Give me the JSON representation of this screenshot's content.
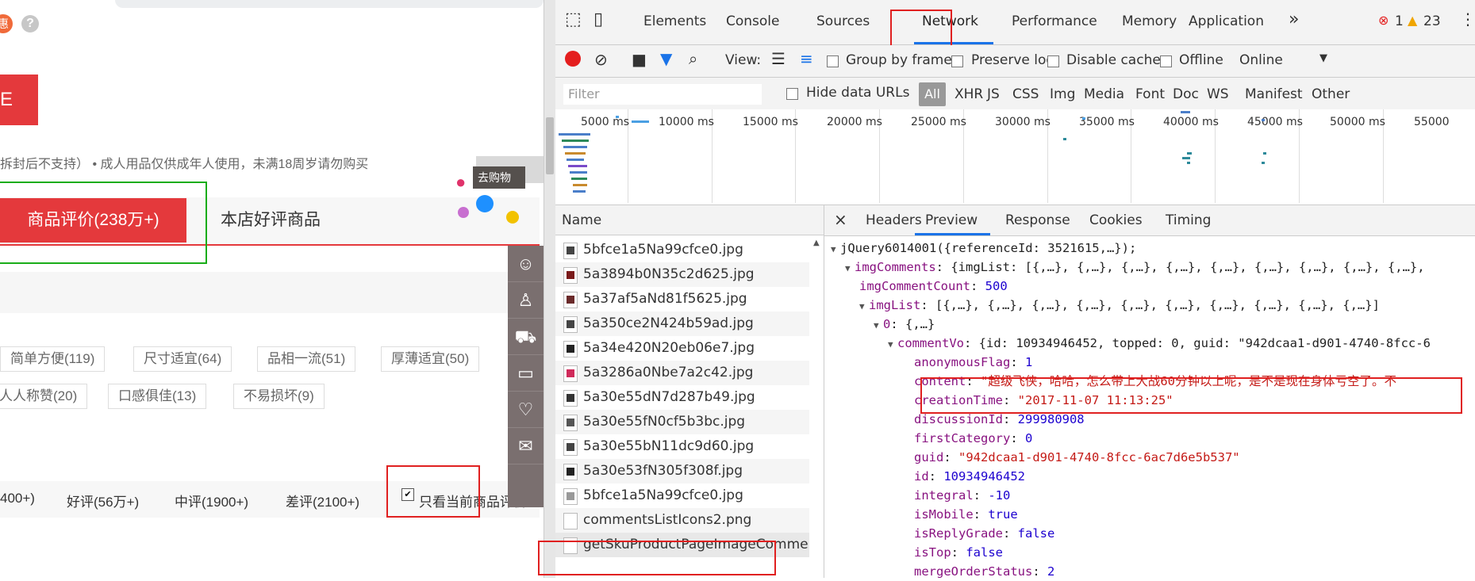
{
  "page": {
    "promo_glyph": "惠",
    "help_glyph": "?",
    "red_button_label": "E",
    "notice": "拆封后不支持）  • 成人用品仅供成年人使用，未满18周岁请勿购买",
    "floatbar_text": "去购物",
    "tabs": {
      "reviews": "商品评价(238万+)",
      "good_products": "本店好评商品"
    },
    "tags": [
      "简单方便(119)",
      "尺寸适宜(64)",
      "品相一流(51)",
      "厚薄适宜(50)",
      "人人称赞(20)",
      "口感俱佳(13)",
      "不易损坏(9)"
    ],
    "filters": [
      "400+)",
      "好评(56万+)",
      "中评(1900+)",
      "差评(2100+)"
    ],
    "only_current_label": "只看当前商品评价",
    "only_current_checked": true
  },
  "devtools": {
    "main_tabs": [
      "Elements",
      "Console",
      "Sources",
      "Network",
      "Performance",
      "Memory",
      "Application"
    ],
    "more_tabs": "»",
    "error_count": "1",
    "warning_count": "23",
    "toolbar": {
      "view_label": "View:",
      "group_by_frame": "Group by frame",
      "preserve_log": "Preserve log",
      "disable_cache": "Disable cache",
      "offline": "Offline",
      "throttle": "Online"
    },
    "filter_placeholder": "Filter",
    "hide_data_urls": "Hide data URLs",
    "type_filters": [
      "All",
      "XHR",
      "JS",
      "CSS",
      "Img",
      "Media",
      "Font",
      "Doc",
      "WS",
      "Manifest",
      "Other"
    ],
    "timeline_ticks": [
      "5000 ms",
      "10000 ms",
      "15000 ms",
      "20000 ms",
      "25000 ms",
      "30000 ms",
      "35000 ms",
      "40000 ms",
      "45000 ms",
      "50000 ms",
      "55000"
    ],
    "name_header": "Name",
    "requests": [
      "5bfce1a5Na99cfce0.jpg",
      "5a3894b0N35c2d625.jpg",
      "5a37af5aNd81f5625.jpg",
      "5a350ce2N424b59ad.jpg",
      "5a34e420N20eb06e7.jpg",
      "5a3286a0Nbe7a2c42.jpg",
      "5a30e55dN7d287b49.jpg",
      "5a30e55fN0cf5b3bc.jpg",
      "5a30e55bN11dc9d60.jpg",
      "5a30e53fN305f308f.jpg",
      "5bfce1a5Na99cfce0.jpg",
      "commentsListIcons2.png",
      "getSkuProductPageImageCommen"
    ],
    "detail_close": "×",
    "detail_tabs": [
      "Headers",
      "Preview",
      "Response",
      "Cookies",
      "Timing"
    ],
    "preview": {
      "root": "jQuery6014001({referenceId: 3521615,…});",
      "imgComments_key": "imgComments",
      "imgComments_val": "{imgList: [{,…}, {,…}, {,…}, {,…}, {,…}, {,…}, {,…}, {,…}, {,…},",
      "imgCommentCount_key": "imgCommentCount",
      "imgCommentCount_val": "500",
      "imgList_key": "imgList",
      "imgList_val": "[{,…}, {,…}, {,…}, {,…}, {,…}, {,…}, {,…}, {,…}, {,…}, {,…}]",
      "idx0_key": "0",
      "idx0_val": "{,…}",
      "commentVo_key": "commentVo",
      "commentVo_val": "{id: 10934946452, topped: 0, guid: \"942dcaa1-d901-4740-8fcc-6",
      "fields": [
        {
          "key": "anonymousFlag",
          "val": "1",
          "type": "n"
        },
        {
          "key": "content",
          "val": "\"超级飞侠，哈哈，怎么带上大战60分钟以上呢，是不是现在身体亏空了。不",
          "type": "s"
        },
        {
          "key": "creationTime",
          "val": "\"2017-11-07 11:13:25\"",
          "type": "s"
        },
        {
          "key": "discussionId",
          "val": "299980908",
          "type": "n"
        },
        {
          "key": "firstCategory",
          "val": "0",
          "type": "n"
        },
        {
          "key": "guid",
          "val": "\"942dcaa1-d901-4740-8fcc-6ac7d6e5b537\"",
          "type": "s"
        },
        {
          "key": "id",
          "val": "10934946452",
          "type": "n"
        },
        {
          "key": "integral",
          "val": "-10",
          "type": "n"
        },
        {
          "key": "isMobile",
          "val": "true",
          "type": "n"
        },
        {
          "key": "isReplyGrade",
          "val": "false",
          "type": "n"
        },
        {
          "key": "isTop",
          "val": "false",
          "type": "n"
        },
        {
          "key": "mergeOrderStatus",
          "val": "2",
          "type": "n"
        }
      ]
    }
  }
}
